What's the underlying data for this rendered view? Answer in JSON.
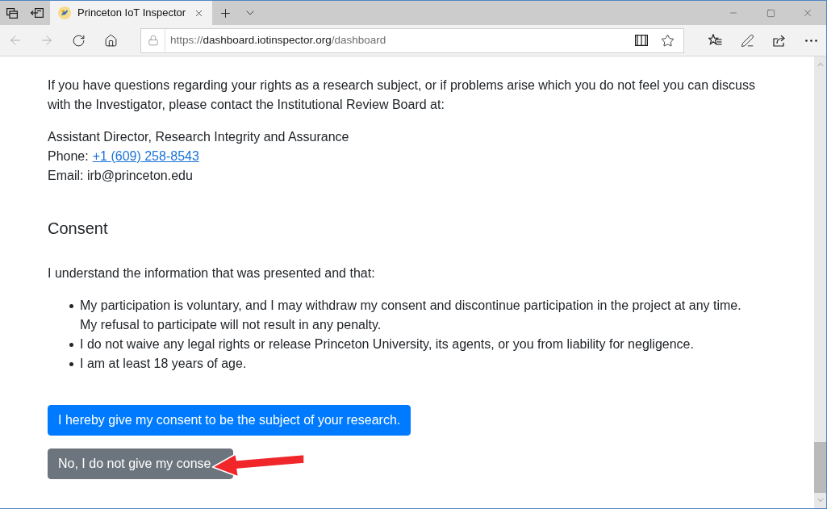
{
  "browser": {
    "tabs": [
      {
        "title": "Princeton IoT Inspector",
        "selected": true
      }
    ],
    "address_bar": {
      "scheme": "https://",
      "host": "dashboard.iotinspector.org",
      "path": "/dashboard"
    }
  },
  "irb_contact": {
    "paragraph": "If you have questions regarding your rights as a research subject, or if problems arise which you do not feel you can discuss with the Investigator, please contact the Institutional Review Board at:",
    "title": "Assistant Director, Research Integrity and Assurance",
    "phone_label": "Phone:",
    "phone": "+1 (609) 258-8543",
    "email": "Email: irb@princeton.edu"
  },
  "consent": {
    "heading": "Consent",
    "intro": "I understand the information that was presented and that:",
    "items": [
      "My participation is voluntary, and I may withdraw my consent and discontinue participation in the project at any time. My refusal to participate will not result in any penalty.",
      "I do not waive any legal rights or release Princeton University, its agents, or you from liability for negligence.",
      "I am at least 18 years of age."
    ]
  },
  "buttons": [
    {
      "label": "I hereby give my consent to be the subject of your research.",
      "kind": "primary"
    },
    {
      "label": "No, I do not give my conse",
      "kind": "secondary"
    }
  ]
}
